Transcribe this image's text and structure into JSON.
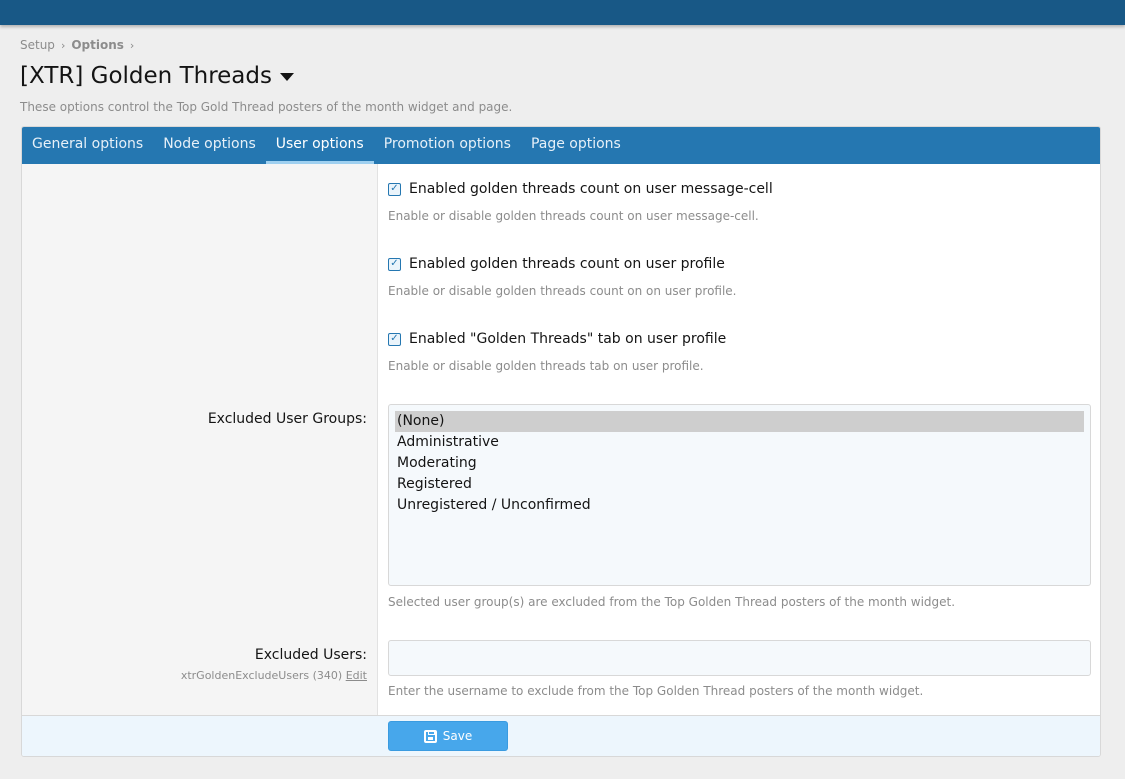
{
  "breadcrumb": {
    "items": [
      "Setup",
      "Options"
    ],
    "separator": "›"
  },
  "page": {
    "title": "[XTR] Golden Threads",
    "description": "These options control the Top Gold Thread posters of the month widget and page."
  },
  "tabs": [
    {
      "label": "General options",
      "active": false
    },
    {
      "label": "Node options",
      "active": false
    },
    {
      "label": "User options",
      "active": true
    },
    {
      "label": "Promotion options",
      "active": false
    },
    {
      "label": "Page options",
      "active": false
    }
  ],
  "options": {
    "checkboxes": [
      {
        "label": "Enabled golden threads count on user message-cell",
        "explain": "Enable or disable golden threads count on user message-cell.",
        "checked": true
      },
      {
        "label": "Enabled golden threads count on user profile",
        "explain": "Enable or disable golden threads count on on user profile.",
        "checked": true
      },
      {
        "label": "Enabled \"Golden Threads\" tab on user profile",
        "explain": "Enable or disable golden threads tab on user profile.",
        "checked": true
      }
    ],
    "excluded_groups": {
      "label": "Excluded User Groups:",
      "options": [
        "(None)",
        "Administrative",
        "Moderating",
        "Registered",
        "Unregistered / Unconfirmed"
      ],
      "selected": "(None)",
      "explain": "Selected user group(s) are excluded from the Top Golden Thread posters of the month widget."
    },
    "excluded_users": {
      "label": "Excluded Users:",
      "hint": "xtrGoldenExcludeUsers (340)",
      "edit_link": "Edit",
      "value": "",
      "explain": "Enter the username to exclude from the Top Golden Thread posters of the month widget."
    }
  },
  "footer": {
    "save_label": "Save"
  },
  "colors": {
    "topbar": "#185886",
    "tabs": "#2577b1",
    "save_button": "#47a7eb"
  }
}
